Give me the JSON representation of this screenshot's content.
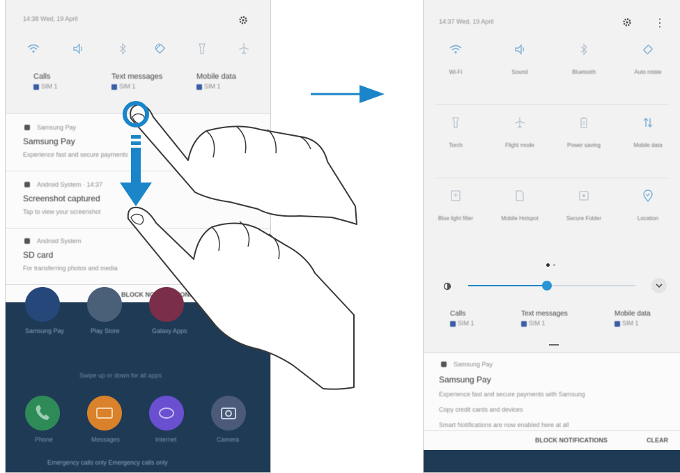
{
  "left_panel": {
    "status_bar": {
      "time_date": "14:38 Wed, 19 April"
    },
    "quick_settings": [
      "wifi-icon",
      "sound-icon",
      "bluetooth-icon",
      "auto-rotate-icon",
      "flashlight-icon",
      "airplane-icon"
    ],
    "sim_row": [
      {
        "label": "Calls",
        "sim": "SIM 1"
      },
      {
        "label": "Text messages",
        "sim": "SIM 1"
      },
      {
        "label": "Mobile data",
        "sim": "SIM 1"
      }
    ],
    "notifications": [
      {
        "app": "Samsung Pay",
        "title": "Samsung Pay",
        "body": "Experience fast and secure payments"
      },
      {
        "app": "Android System · 14:37",
        "title": "Screenshot captured",
        "body": "Tap to view your screenshot"
      },
      {
        "app": "Android System",
        "title": "SD card",
        "body": "For transferring photos and media"
      }
    ],
    "block_notifications": "BLOCK NOTIFICATIONS",
    "home": {
      "top_apps": [
        "Samsung Pay",
        "Play Store",
        "Galaxy Apps"
      ],
      "folder_hint": "Swipe up or down for all apps",
      "dock": [
        {
          "label": "Phone",
          "color": "#2e8b57"
        },
        {
          "label": "Messages",
          "color": "#d9822b"
        },
        {
          "label": "Internet",
          "color": "#6a4fd1"
        },
        {
          "label": "Camera",
          "color": "#4a5a78"
        }
      ],
      "emergency": "Emergency calls only Emergency calls only"
    }
  },
  "right_panel": {
    "status_bar": {
      "time_date": "14:37 Wed, 19 April"
    },
    "tiles": [
      {
        "label": "Wi-Fi",
        "icon": "wifi-icon",
        "active": true
      },
      {
        "label": "Sound",
        "icon": "sound-icon",
        "active": true
      },
      {
        "label": "Bluetooth",
        "icon": "bluetooth-icon",
        "active": false
      },
      {
        "label": "Auto rotate",
        "icon": "auto-rotate-icon",
        "active": true
      },
      {
        "label": "Torch",
        "icon": "flashlight-icon",
        "active": false
      },
      {
        "label": "Flight mode",
        "icon": "airplane-icon",
        "active": false
      },
      {
        "label": "Power saving",
        "icon": "battery-icon",
        "active": false
      },
      {
        "label": "Mobile data",
        "icon": "mobile-data-icon",
        "active": true
      },
      {
        "label": "Blue light filter",
        "icon": "blue-light-icon",
        "active": false
      },
      {
        "label": "Mobile Hotspot",
        "icon": "hotspot-icon",
        "active": false
      },
      {
        "label": "Secure Folder",
        "icon": "secure-folder-icon",
        "active": false
      },
      {
        "label": "Location",
        "icon": "location-icon",
        "active": true
      }
    ],
    "brightness_fraction": 0.47,
    "sim_row": [
      {
        "label": "Calls",
        "sim": "SIM 1"
      },
      {
        "label": "Text messages",
        "sim": "SIM 1"
      },
      {
        "label": "Mobile data",
        "sim": "SIM 1"
      }
    ],
    "notification": {
      "app": "Samsung Pay",
      "title": "Samsung Pay",
      "lines": [
        "Experience fast and secure payments with Samsung",
        "Copy credit cards and devices",
        "Smart Notifications are now enabled here at all"
      ]
    },
    "actions": {
      "block": "BLOCK NOTIFICATIONS",
      "clear": "CLEAR"
    }
  },
  "colors": {
    "accent": "#1a85c8",
    "qs_icon": "#7fb2d9",
    "home_bg": "#1f3a55"
  }
}
